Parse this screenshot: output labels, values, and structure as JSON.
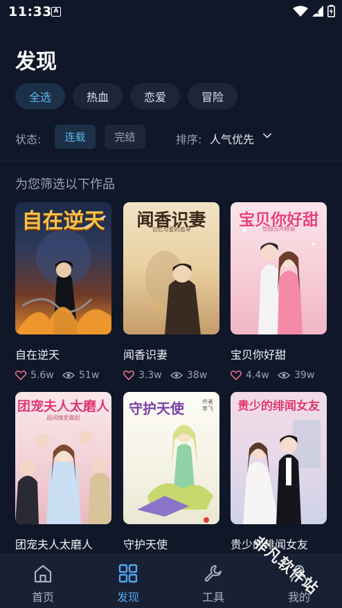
{
  "status_bar": {
    "time": "11:33",
    "a_badge": "A"
  },
  "page": {
    "title": "发现"
  },
  "genres": [
    {
      "label": "全选",
      "active": true
    },
    {
      "label": "热血",
      "active": false
    },
    {
      "label": "恋爱",
      "active": false
    },
    {
      "label": "冒险",
      "active": false
    }
  ],
  "filters": {
    "status_label": "状态:",
    "status_options": [
      {
        "label": "连载",
        "active": true
      },
      {
        "label": "完结",
        "active": false
      }
    ],
    "sort_label": "排序:",
    "sort_value": "人气优先"
  },
  "section_title": "为您筛选以下作品",
  "comics": [
    {
      "name": "自在逆天",
      "likes": "5.6w",
      "views": "51w",
      "cover_title": "自在逆天",
      "cover_subtitle": ""
    },
    {
      "name": "闻香识妻",
      "likes": "3.3w",
      "views": "38w",
      "cover_title": "闻香识妻",
      "cover_subtitle": "记忆与爱的追寻"
    },
    {
      "name": "宝贝你好甜",
      "likes": "4.4w",
      "views": "39w",
      "cover_title": "宝贝你好甜",
      "cover_subtitle": "恰园古风物语"
    },
    {
      "name": "团宠夫人太磨人",
      "likes": "",
      "views": "",
      "cover_title": "团宠夫人太磨人",
      "cover_subtitle": "超闲情爱霸剧"
    },
    {
      "name": "守护天使",
      "likes": "",
      "views": "",
      "cover_title": "守护天使",
      "cover_subtitle": "作者 李飞"
    },
    {
      "name": "贵少的绯闻女友",
      "likes": "",
      "views": "",
      "cover_title": "贵少的绯闻女友",
      "cover_subtitle": ""
    }
  ],
  "nav": [
    {
      "label": "首页",
      "icon": "home-icon",
      "active": false
    },
    {
      "label": "发现",
      "icon": "grid-icon",
      "active": true
    },
    {
      "label": "工具",
      "icon": "wrench-icon",
      "active": false
    },
    {
      "label": "我的",
      "icon": "user-icon",
      "active": false
    }
  ],
  "watermark": "非凡软件站",
  "colors": {
    "background": "#0f1728",
    "accent": "#4fa9ee",
    "like": "#e56d86"
  }
}
